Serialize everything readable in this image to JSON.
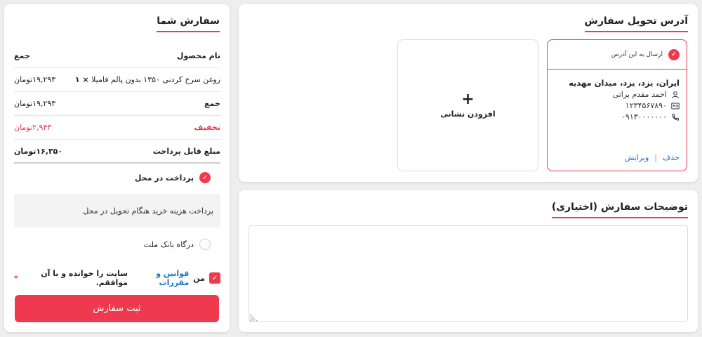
{
  "address": {
    "title": "آدرس تحویل سفارش",
    "add_label": "افزودن نشانی",
    "add_icon": "+",
    "item": {
      "send_label": "ارسال به این آدرس",
      "address_line": "ایران، یزد، یزد، میدان مهدیه",
      "name": "احمد مقدم براتی",
      "postal_code": "۱۲۳۴۵۶۷۸۹۰",
      "phone": "۰۹۱۳۰۰۰۰۰۰۰",
      "delete_label": "حذف",
      "separator": "|",
      "edit_label": "ویرایش"
    }
  },
  "description": {
    "title": "توضیحات سفارش (اختیاری)",
    "value": ""
  },
  "order": {
    "title": "سفارش شما",
    "header_product": "نام محصول",
    "header_total": "جمع",
    "product_name": "روغن سرخ کردنی ۱۳۵۰ بدون پالم فامیلا",
    "product_qty": "× ۱",
    "product_price": "۱۹,۲۹۳تومان",
    "subtotal_label": "جمع",
    "subtotal_value": "۱۹,۲۹۳تومان",
    "discount_label": "تخفیف",
    "discount_value": "۲,۹۴۳تومان",
    "payable_label": "مبلغ قابل پرداخت",
    "payable_value": "۱۶,۳۵۰تومان"
  },
  "payment": {
    "cod_label": "پرداخت در محل",
    "cod_description": "پرداخت هزینه خرید هنگام تحویل در محل",
    "bank_label": "درگاه بانک ملت"
  },
  "terms": {
    "prefix": "من",
    "link": "قوانین و مقررات",
    "suffix": "سایت را خوانده و با آن موافقم.",
    "required_mark": "*"
  },
  "submit": {
    "label": "ثبت سفارش"
  },
  "colors": {
    "accent": "#ef394e",
    "link": "#1a73c8"
  }
}
